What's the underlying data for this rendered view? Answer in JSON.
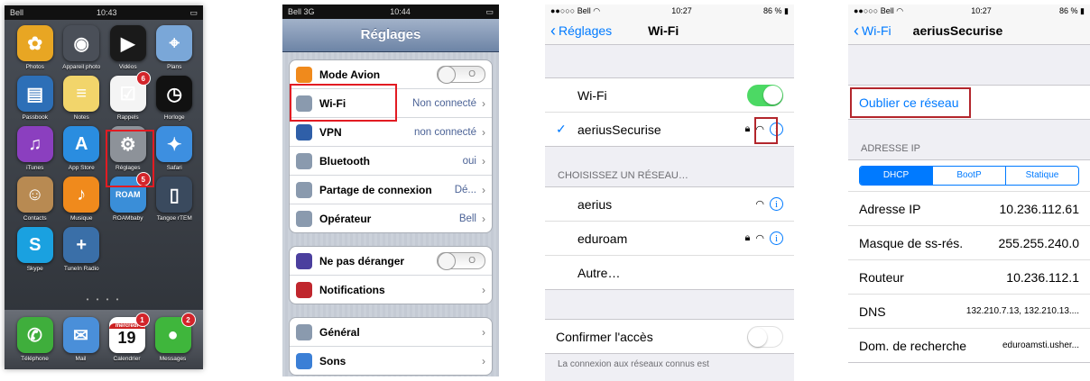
{
  "home": {
    "status": {
      "carrier": "Bell",
      "time": "10:43"
    },
    "apps": [
      {
        "name": "Photos",
        "icon": "sunflower-icon",
        "glyph": "✿",
        "color": "#e8a623"
      },
      {
        "name": "Appareil photo",
        "icon": "camera-icon",
        "glyph": "◉",
        "color": "#4a4f58"
      },
      {
        "name": "Vidéos",
        "icon": "film-icon",
        "glyph": "▶",
        "color": "#1a1a1a"
      },
      {
        "name": "Plans",
        "icon": "map-icon",
        "glyph": "⌖",
        "color": "#7aa7d8"
      },
      {
        "name": "Passbook",
        "icon": "wallet-icon",
        "glyph": "▤",
        "color": "#2d6fb7"
      },
      {
        "name": "Notes",
        "icon": "notepad-icon",
        "glyph": "≡",
        "color": "#f2d56b"
      },
      {
        "name": "Rappels",
        "icon": "checklist-icon",
        "glyph": "☑",
        "color": "#f4f4f4",
        "badge": "6"
      },
      {
        "name": "Horloge",
        "icon": "clock-icon",
        "glyph": "◷",
        "color": "#111111"
      },
      {
        "name": "iTunes",
        "icon": "music-note-icon",
        "glyph": "♫",
        "color": "#8b3fbf"
      },
      {
        "name": "App Store",
        "icon": "app-store-icon",
        "glyph": "A",
        "color": "#2a8de0"
      },
      {
        "name": "Réglages",
        "icon": "gear-icon",
        "glyph": "⚙",
        "color": "#8d9299"
      },
      {
        "name": "Safari",
        "icon": "compass-icon",
        "glyph": "✦",
        "color": "#3d8fe0"
      },
      {
        "name": "Contacts",
        "icon": "contacts-icon",
        "glyph": "☺",
        "color": "#b88a52"
      },
      {
        "name": "Musique",
        "icon": "music-icon",
        "glyph": "♪",
        "color": "#f08a1c"
      },
      {
        "name": "ROAMbaby",
        "icon": "roam-icon",
        "glyph": "ROAM",
        "color": "#3a8ed8",
        "badge": "5"
      },
      {
        "name": "Tangoe rTEM",
        "icon": "phone-app-icon",
        "glyph": "▯",
        "color": "#3a4a5e"
      },
      {
        "name": "Skype",
        "icon": "skype-icon",
        "glyph": "S",
        "color": "#1aa1e0"
      },
      {
        "name": "TuneIn Radio",
        "icon": "radio-icon",
        "glyph": "+",
        "color": "#3a6fa8"
      }
    ],
    "dock": [
      {
        "name": "Téléphone",
        "icon": "phone-icon",
        "glyph": "✆",
        "color": "#3fae3c"
      },
      {
        "name": "Mail",
        "icon": "mail-icon",
        "glyph": "✉",
        "color": "#4a8fd9"
      },
      {
        "name": "Calendrier",
        "icon": "calendar-icon",
        "glyph": "19",
        "color": "#ffffff",
        "badge": "1",
        "day": "mercredi"
      },
      {
        "name": "Messages",
        "icon": "messages-icon",
        "glyph": "●",
        "color": "#3fb63c",
        "badge": "2"
      }
    ]
  },
  "settings": {
    "status": {
      "carrier": "Bell",
      "network": "3G",
      "time": "10:44"
    },
    "title": "Réglages",
    "groups": [
      [
        {
          "label": "Mode Avion",
          "icon": "airplane-icon",
          "color": "#f08a1c",
          "toggle": "O"
        },
        {
          "label": "Wi-Fi",
          "icon": "wifi-icon",
          "color": "#8a9aae",
          "value": "Non connecté"
        },
        {
          "label": "VPN",
          "icon": "vpn-icon",
          "color": "#2f5fa8",
          "value": "non connecté"
        },
        {
          "label": "Bluetooth",
          "icon": "bluetooth-icon",
          "color": "#8a9aae",
          "value": "oui"
        },
        {
          "label": "Partage de connexion",
          "icon": "link-icon",
          "color": "#8a9aae",
          "value": "Dé..."
        },
        {
          "label": "Opérateur",
          "icon": "phone-icon",
          "color": "#8a9aae",
          "value": "Bell"
        }
      ],
      [
        {
          "label": "Ne pas déranger",
          "icon": "moon-icon",
          "color": "#4b3f9e",
          "toggle": "O"
        },
        {
          "label": "Notifications",
          "icon": "notifications-icon",
          "color": "#c0262d"
        }
      ],
      [
        {
          "label": "Général",
          "icon": "gear-icon",
          "color": "#8a9aae"
        },
        {
          "label": "Sons",
          "icon": "speaker-icon",
          "color": "#3b7fd6"
        }
      ]
    ]
  },
  "wifi": {
    "status": {
      "carrier": "Bell",
      "time": "10:27",
      "battery": "86 %"
    },
    "back": "Réglages",
    "title": "Wi-Fi",
    "wifi_label": "Wi-Fi",
    "connected": "aeriusSecurise",
    "section_header": "CHOISISSEZ UN RÉSEAU…",
    "networks": [
      {
        "name": "aerius",
        "locked": false
      },
      {
        "name": "eduroam",
        "locked": true
      }
    ],
    "other": "Autre…",
    "confirm_label": "Confirmer l'accès",
    "footer": "La connexion aux réseaux connus est"
  },
  "network": {
    "status": {
      "carrier": "Bell",
      "time": "10:27",
      "battery": "86 %"
    },
    "back": "Wi-Fi",
    "title": "aeriusSecurise",
    "forget": "Oublier ce réseau",
    "ip_header": "ADRESSE IP",
    "segments": [
      "DHCP",
      "BootP",
      "Statique"
    ],
    "rows": [
      {
        "label": "Adresse IP",
        "value": "10.236.112.61"
      },
      {
        "label": "Masque de ss-rés.",
        "value": "255.255.240.0"
      },
      {
        "label": "Routeur",
        "value": "10.236.112.1"
      },
      {
        "label": "DNS",
        "value": "132.210.7.13, 132.210.13...."
      },
      {
        "label": "Dom. de recherche",
        "value": "eduroamsti.usher..."
      }
    ]
  }
}
